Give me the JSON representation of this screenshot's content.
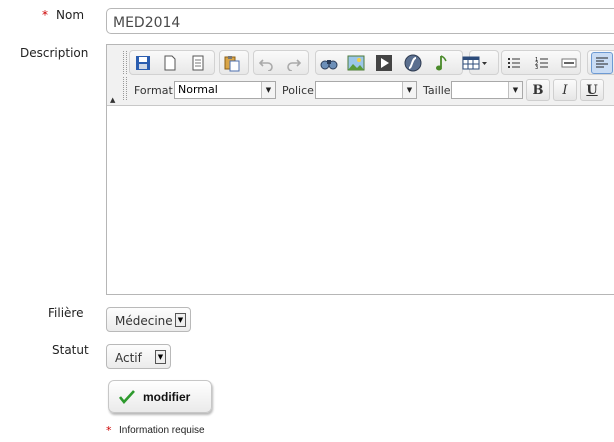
{
  "form": {
    "nom": {
      "required_mark": "*",
      "label": "Nom",
      "value": "MED2014"
    },
    "description": {
      "label": "Description",
      "content": ""
    },
    "filiere": {
      "label": "Filière",
      "selected": "Médecine"
    },
    "statut": {
      "label": "Statut",
      "selected": "Actif"
    },
    "submit_label": "modifier",
    "required_note": "Information requise",
    "required_note_mark": "*"
  },
  "editor": {
    "toolbar_icons": [
      "save-icon",
      "new-page-icon",
      "templates-icon",
      "paste-icon",
      "undo-icon",
      "redo-icon",
      "find-replace-icon",
      "image-icon",
      "video-icon",
      "flash-icon",
      "audio-icon",
      "table-icon",
      "bulleted-list-icon",
      "numbered-list-icon",
      "horizontal-rule-icon",
      "align-left-icon"
    ],
    "format_label": "Format",
    "format_value": "Normal",
    "police_label": "Police",
    "police_value": "",
    "taille_label": "Taille",
    "taille_value": "",
    "bold_label": "B",
    "italic_label": "I",
    "underline_label": "U"
  },
  "colors": {
    "required": "#cc0000",
    "check": "#2e9a2e"
  }
}
